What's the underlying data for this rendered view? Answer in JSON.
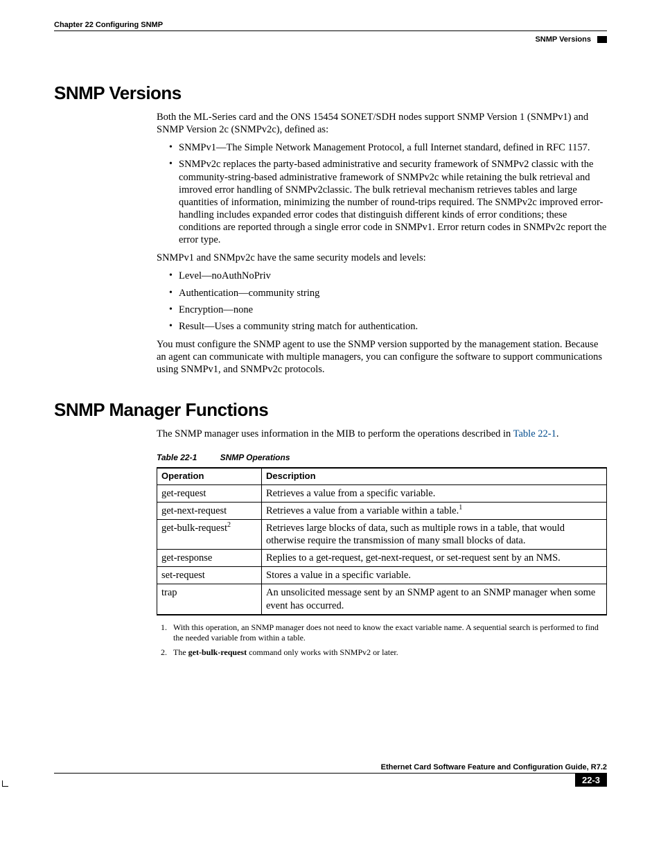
{
  "header": {
    "chapter": "Chapter 22  Configuring SNMP",
    "section_right": "SNMP Versions"
  },
  "sec1": {
    "title": "SNMP Versions",
    "p1": "Both the ML-Series card and the ONS 15454 SONET/SDH nodes support SNMP Version 1 (SNMPv1) and SNMP Version 2c (SNMPv2c), defined as:",
    "b1": "SNMPv1—The Simple Network Management Protocol, a full Internet standard, defined in RFC 1157.",
    "b2": "SNMPv2c replaces the party-based administrative and security framework of SNMPv2 classic with the community-string-based administrative framework of SNMPv2c while retaining the bulk retrieval and imroved error handling of SNMPv2classic. The bulk retrieval mechanism retrieves tables and large quantities of information, minimizing the number of round-trips required. The SNMPv2c improved error-handling includes expanded error codes that distinguish different kinds of error conditions; these conditions are reported through a single error code in SNMPv1. Error return codes in SNMPv2c report the error type.",
    "p2": "SNMPv1 and SNMpv2c have the same security models and levels:",
    "s1": "Level—noAuthNoPriv",
    "s2": "Authentication—community string",
    "s3": "Encryption—none",
    "s4": "Result—Uses a community string match for authentication.",
    "p3": "You must configure the SNMP agent to use the SNMP version supported by the management station. Because an agent can communicate with multiple managers, you can configure the software to support communications using SNMPv1, and SNMPv2c protocols."
  },
  "sec2": {
    "title": "SNMP Manager Functions",
    "p1a": "The SNMP manager uses information in the MIB to perform the operations described in ",
    "p1link": "Table 22-1",
    "p1b": "."
  },
  "table": {
    "caption_num": "Table 22-1",
    "caption_title": "SNMP Operations",
    "h1": "Operation",
    "h2": "Description",
    "rows": [
      {
        "op": "get-request",
        "desc": "Retrieves a value from a specific variable."
      },
      {
        "op": "get-next-request",
        "desc": "Retrieves a value from a variable within a table.",
        "sup_desc": "1"
      },
      {
        "op": "get-bulk-request",
        "sup_op": "2",
        "desc": "Retrieves large blocks of data, such as multiple rows in a table, that would otherwise require the transmission of many small blocks of data."
      },
      {
        "op": "get-response",
        "desc": "Replies to a get-request, get-next-request, or set-request sent by an NMS."
      },
      {
        "op": "set-request",
        "desc": "Stores a value in a specific variable."
      },
      {
        "op": "trap",
        "desc": "An unsolicited message sent by an SNMP agent to an SNMP manager when some event has occurred."
      }
    ]
  },
  "footnotes": {
    "f1": "With this operation, an SNMP manager does not need to know the exact variable name. A sequential search is performed to find the needed variable from within a table.",
    "f2a": "The ",
    "f2bold": "get-bulk-request",
    "f2b": " command only works with SNMPv2 or later."
  },
  "footer": {
    "title": "Ethernet Card Software Feature and Configuration Guide, R7.2",
    "page": "22-3"
  }
}
